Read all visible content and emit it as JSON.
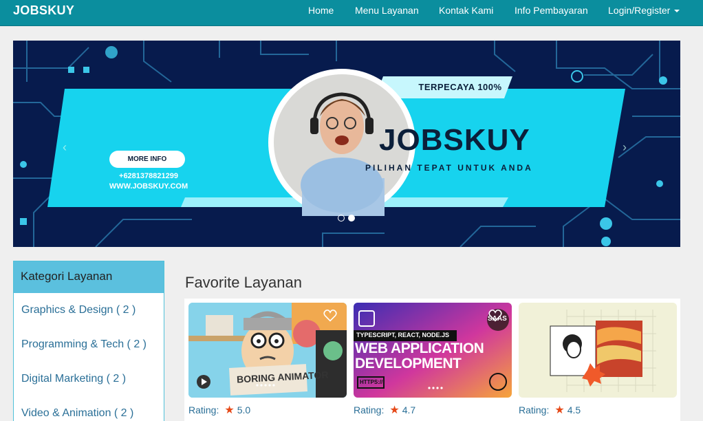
{
  "navbar": {
    "brand": "JOBSKUY",
    "items": [
      "Home",
      "Menu Layanan",
      "Kontak Kami",
      "Info Pembayaran",
      "Login/Register"
    ]
  },
  "banner": {
    "badge": "TERPECAYA 100%",
    "title": "JOBSKUY",
    "tagline": "PILIHAN TEPAT UNTUK ANDA",
    "more_info": "MORE INFO",
    "phone": "+6281378821299",
    "website": "WWW.JOBSKUY.COM",
    "prev_arrow": "‹",
    "next_arrow": "›"
  },
  "sidebar": {
    "title": "Kategori Layanan",
    "items": [
      "Graphics & Design ( 2 )",
      "Programming & Tech ( 2 )",
      "Digital Marketing ( 2 )",
      "Video & Animation ( 2 )"
    ]
  },
  "main": {
    "section_title": "Favorite Layanan",
    "rating_label": "Rating:",
    "cards": [
      {
        "image_text": "BORING ANIMATOR",
        "rating": "5.0"
      },
      {
        "image_text_top": "TYPESCRIPT, REACT, NODE.JS",
        "image_text_main1": "WEB APPLICATION",
        "image_text_main2": "DEVELOPMENT",
        "image_badge": "SAAS",
        "image_small": "HTTPS://",
        "rating": "4.7"
      },
      {
        "rating": "4.5"
      }
    ]
  },
  "colors": {
    "navbar": "#0b8e9e",
    "accent": "#17d3ee",
    "banner_bg": "#071b4d",
    "link": "#2a6f97",
    "star": "#e64a19"
  }
}
